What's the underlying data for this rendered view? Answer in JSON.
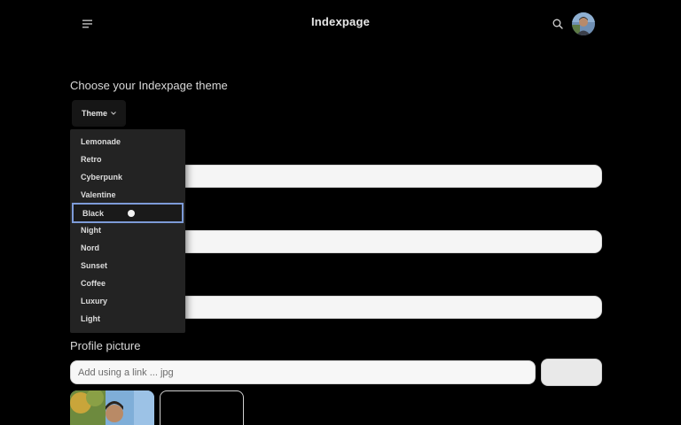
{
  "header": {
    "brand": "Indexpage",
    "menu_icon": "menu-icon",
    "search_icon": "search-icon"
  },
  "theme": {
    "title": "Choose your Indexpage theme",
    "button_label": "Theme",
    "options": [
      "Lemonade",
      "Retro",
      "Cyberpunk",
      "Valentine",
      "Black",
      "Night",
      "Nord",
      "Sunset",
      "Coffee",
      "Luxury",
      "Light"
    ],
    "selected": "Black",
    "accent": "#7d9bd8"
  },
  "profile": {
    "label": "Profile picture",
    "link_placeholder": "Add using a link ... jpg"
  }
}
